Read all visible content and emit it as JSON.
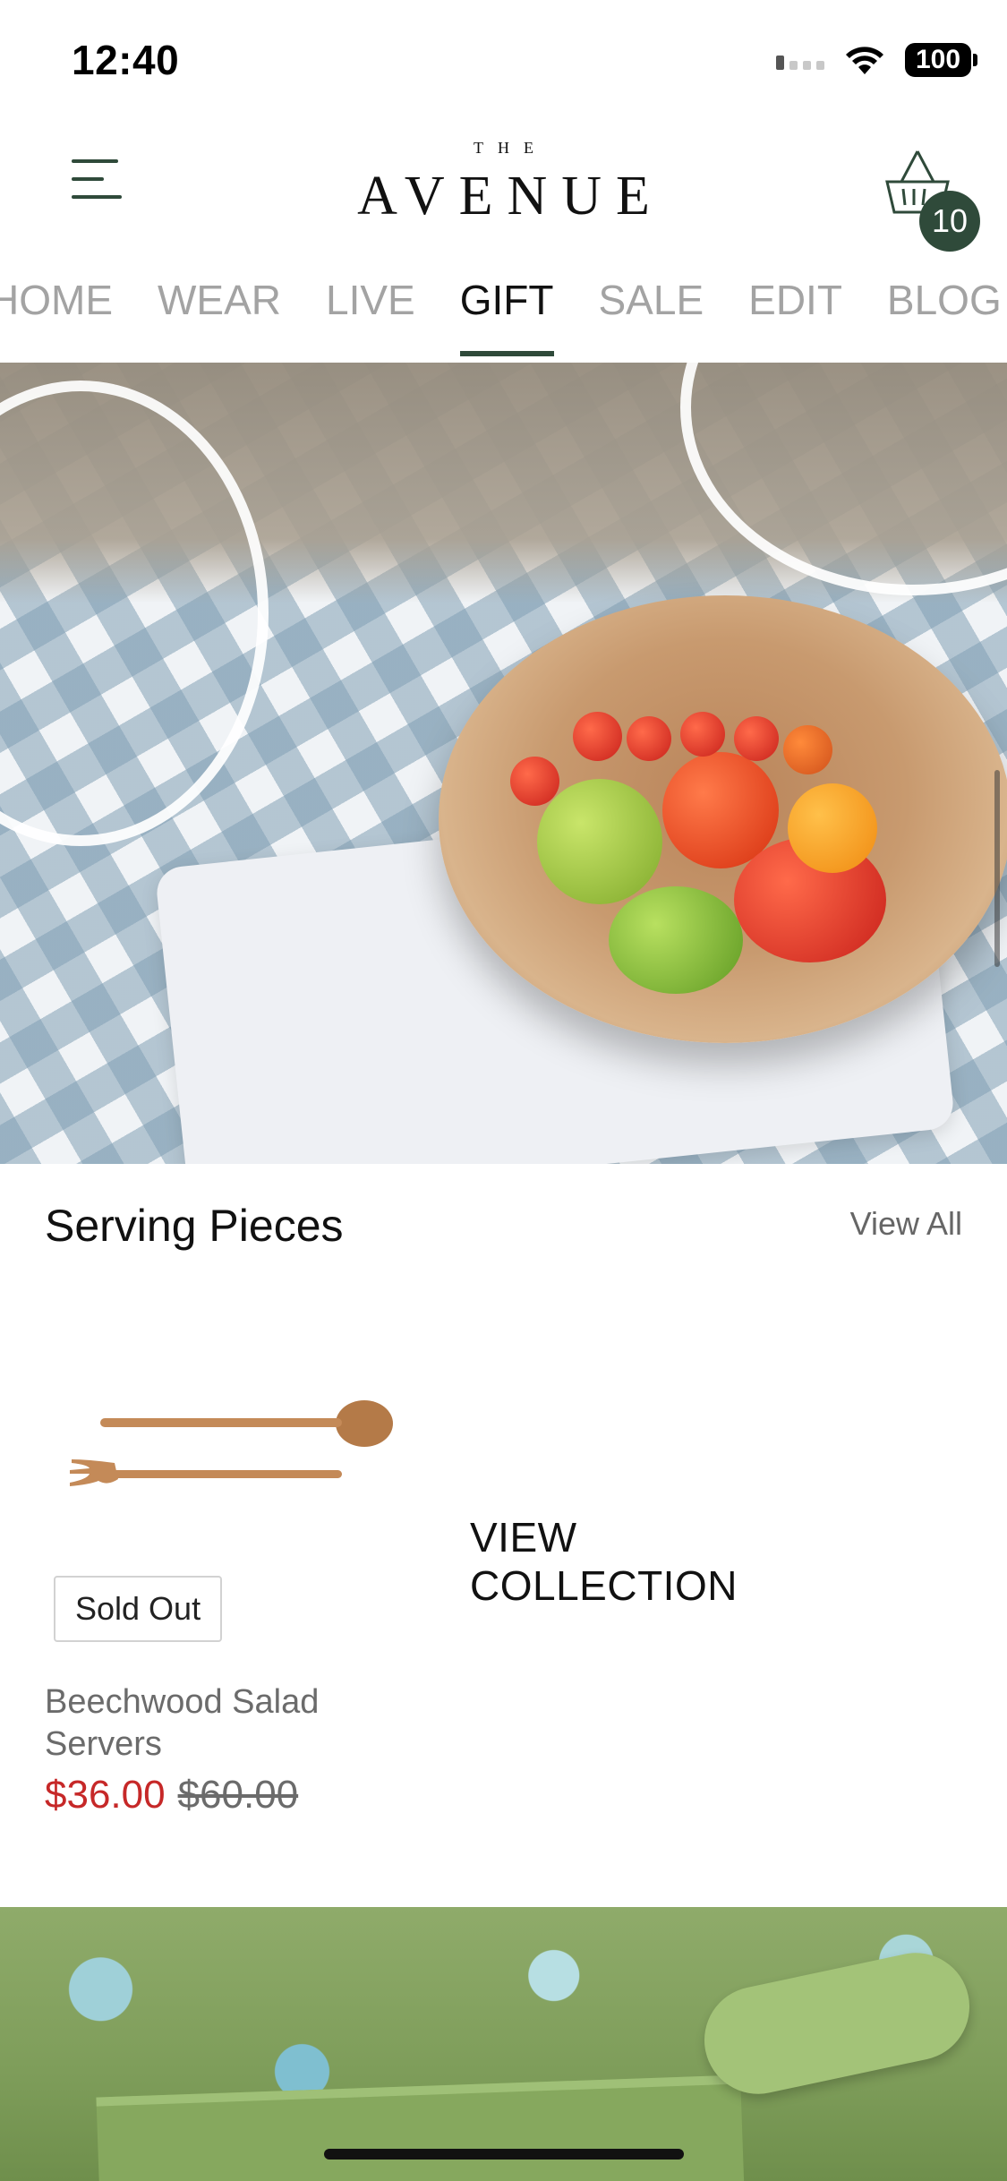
{
  "status_bar": {
    "time": "12:40",
    "battery": "100"
  },
  "header": {
    "logo_small": "THE",
    "logo_main": "AVENUE",
    "cart_count": "10"
  },
  "nav": {
    "tabs": [
      {
        "label": "HOME",
        "active": false
      },
      {
        "label": "WEAR",
        "active": false
      },
      {
        "label": "LIVE",
        "active": false
      },
      {
        "label": "GIFT",
        "active": true
      },
      {
        "label": "SALE",
        "active": false
      },
      {
        "label": "EDIT",
        "active": false
      },
      {
        "label": "BLOG",
        "active": false
      }
    ]
  },
  "section": {
    "title": "Serving Pieces",
    "view_all": "View All"
  },
  "product": {
    "badge": "Sold Out",
    "name": "Beechwood Salad Servers",
    "price_sale": "$36.00",
    "price_original": "$60.00"
  },
  "collection": {
    "label_line1": "VIEW",
    "label_line2": "COLLECTION"
  },
  "colors": {
    "accent": "#2f4a3a",
    "sale": "#c62828"
  }
}
